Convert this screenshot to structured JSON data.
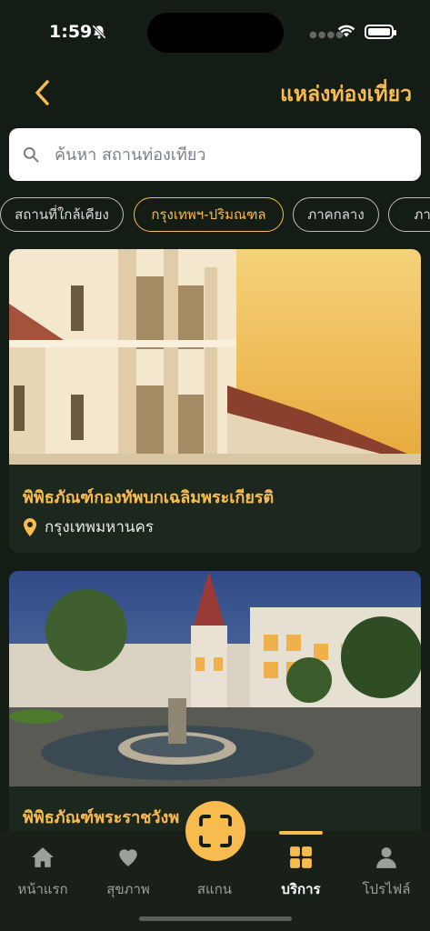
{
  "status": {
    "time": "1:59"
  },
  "header": {
    "title": "แหล่งท่องเที่ยว",
    "back_icon": "chevron-left-icon"
  },
  "search": {
    "placeholder": "ค้นหา สถานท่องเที่ยว",
    "value": ""
  },
  "chips": [
    {
      "label": "สถานที่ใกล้เคียง",
      "active": false
    },
    {
      "label": "กรุงเทพฯ-ปริมณฑล",
      "active": true
    },
    {
      "label": "ภาคกลาง",
      "active": false
    },
    {
      "label": "ภาคต",
      "active": false
    }
  ],
  "cards": [
    {
      "title": "พิพิธภัณฑ์กองทัพบกเฉลิมพระเกียรติ",
      "location": "กรุงเทพมหานคร"
    },
    {
      "title": "พิพิธภัณฑ์พระราชวังพ"
    }
  ],
  "nav": {
    "items": [
      {
        "label": "หน้าแรก",
        "icon": "home-icon"
      },
      {
        "label": "สุขภาพ",
        "icon": "heart-icon"
      },
      {
        "label": "สแกน",
        "icon": "scan-icon"
      },
      {
        "label": "บริการ",
        "icon": "grid-icon",
        "active": true
      },
      {
        "label": "โปรไฟล์",
        "icon": "user-icon"
      }
    ]
  },
  "colors": {
    "accent": "#f7bb50",
    "background": "#131c15",
    "card": "#1c271e"
  }
}
